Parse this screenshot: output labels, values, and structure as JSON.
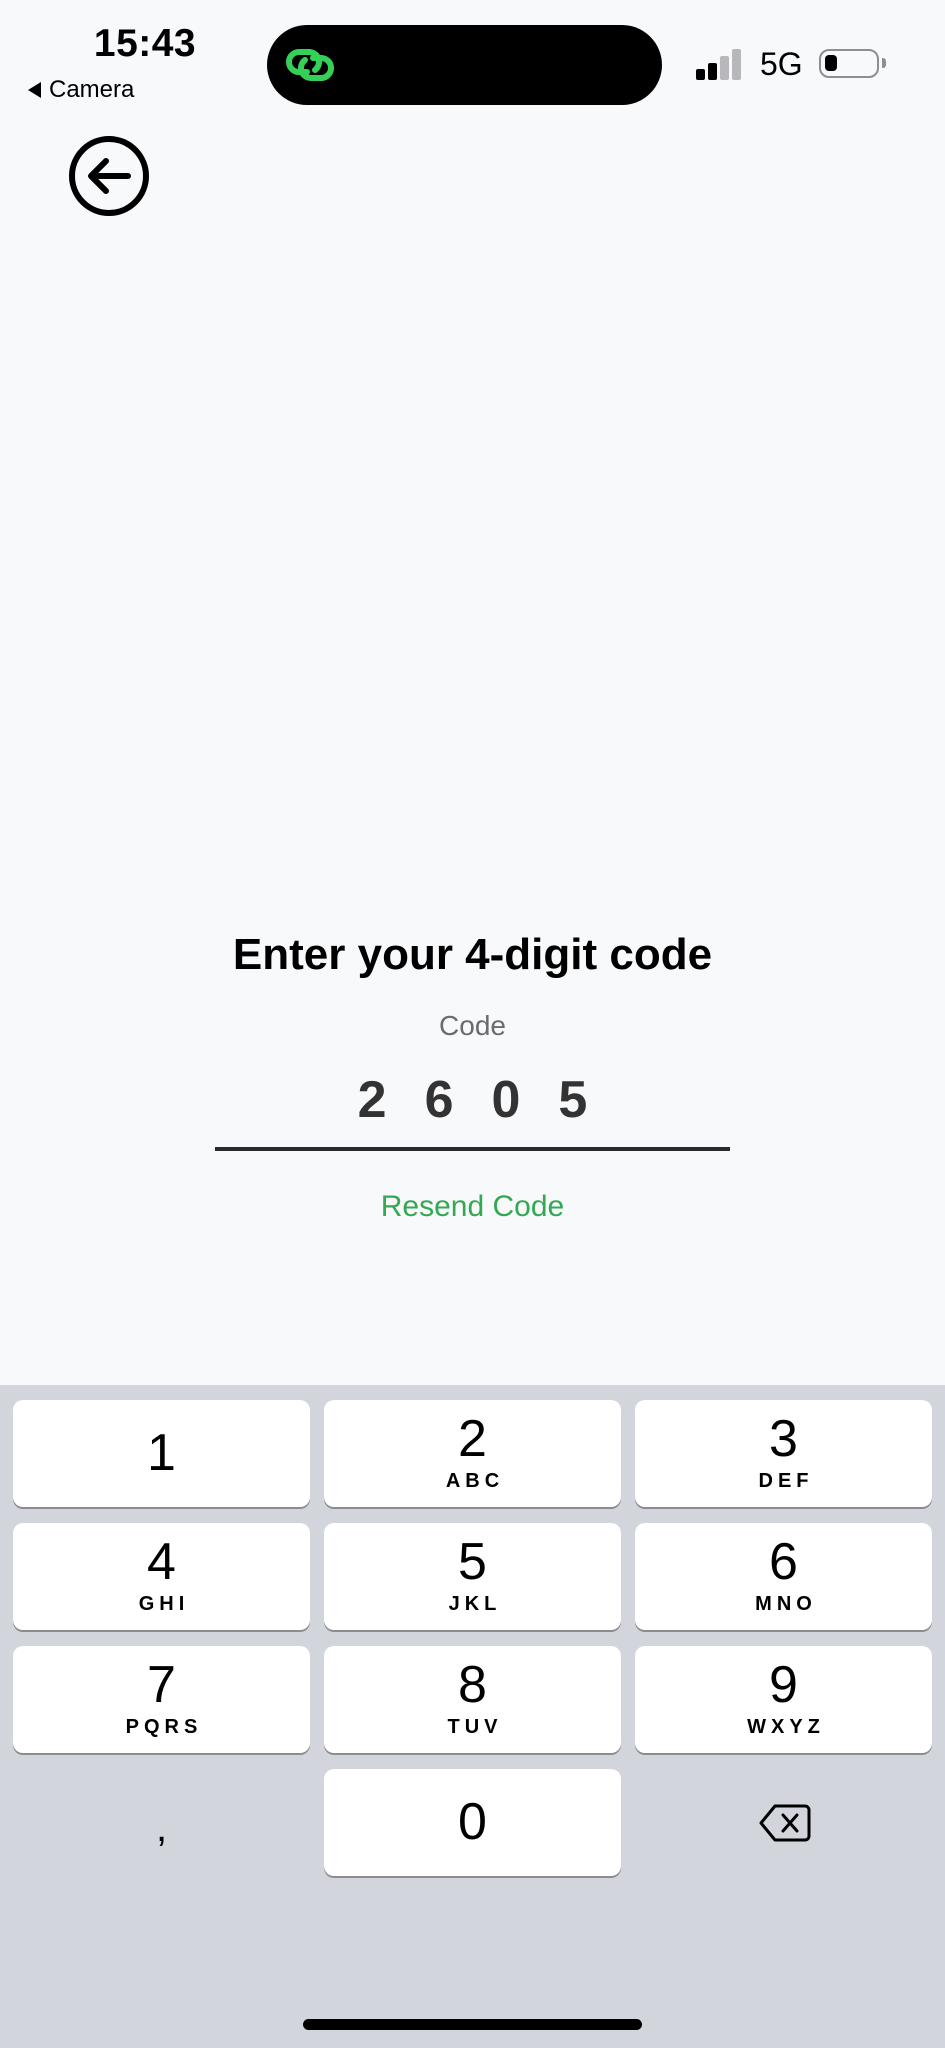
{
  "status_bar": {
    "time": "15:43",
    "back_app": "Camera",
    "network": "5G",
    "signal_bars_active": 2,
    "battery_level": 0.15
  },
  "colors": {
    "accent": "#34a853",
    "island_icon": "#34d058",
    "background": "#f8f9fb",
    "keyboard": "#d2d5db"
  },
  "icons": {
    "back": "arrow-left-circle-icon",
    "island": "linked-rings-icon",
    "delete": "backspace-icon"
  },
  "code_entry": {
    "heading": "Enter your 4-digit code",
    "label": "Code",
    "value": "2605",
    "resend_label": "Resend Code"
  },
  "keyboard": {
    "keys": [
      {
        "num": "1",
        "letters": ""
      },
      {
        "num": "2",
        "letters": "ABC"
      },
      {
        "num": "3",
        "letters": "DEF"
      },
      {
        "num": "4",
        "letters": "GHI"
      },
      {
        "num": "5",
        "letters": "JKL"
      },
      {
        "num": "6",
        "letters": "MNO"
      },
      {
        "num": "7",
        "letters": "PQRS"
      },
      {
        "num": "8",
        "letters": "TUV"
      },
      {
        "num": "9",
        "letters": "WXYZ"
      }
    ],
    "comma": ",",
    "zero": "0"
  }
}
